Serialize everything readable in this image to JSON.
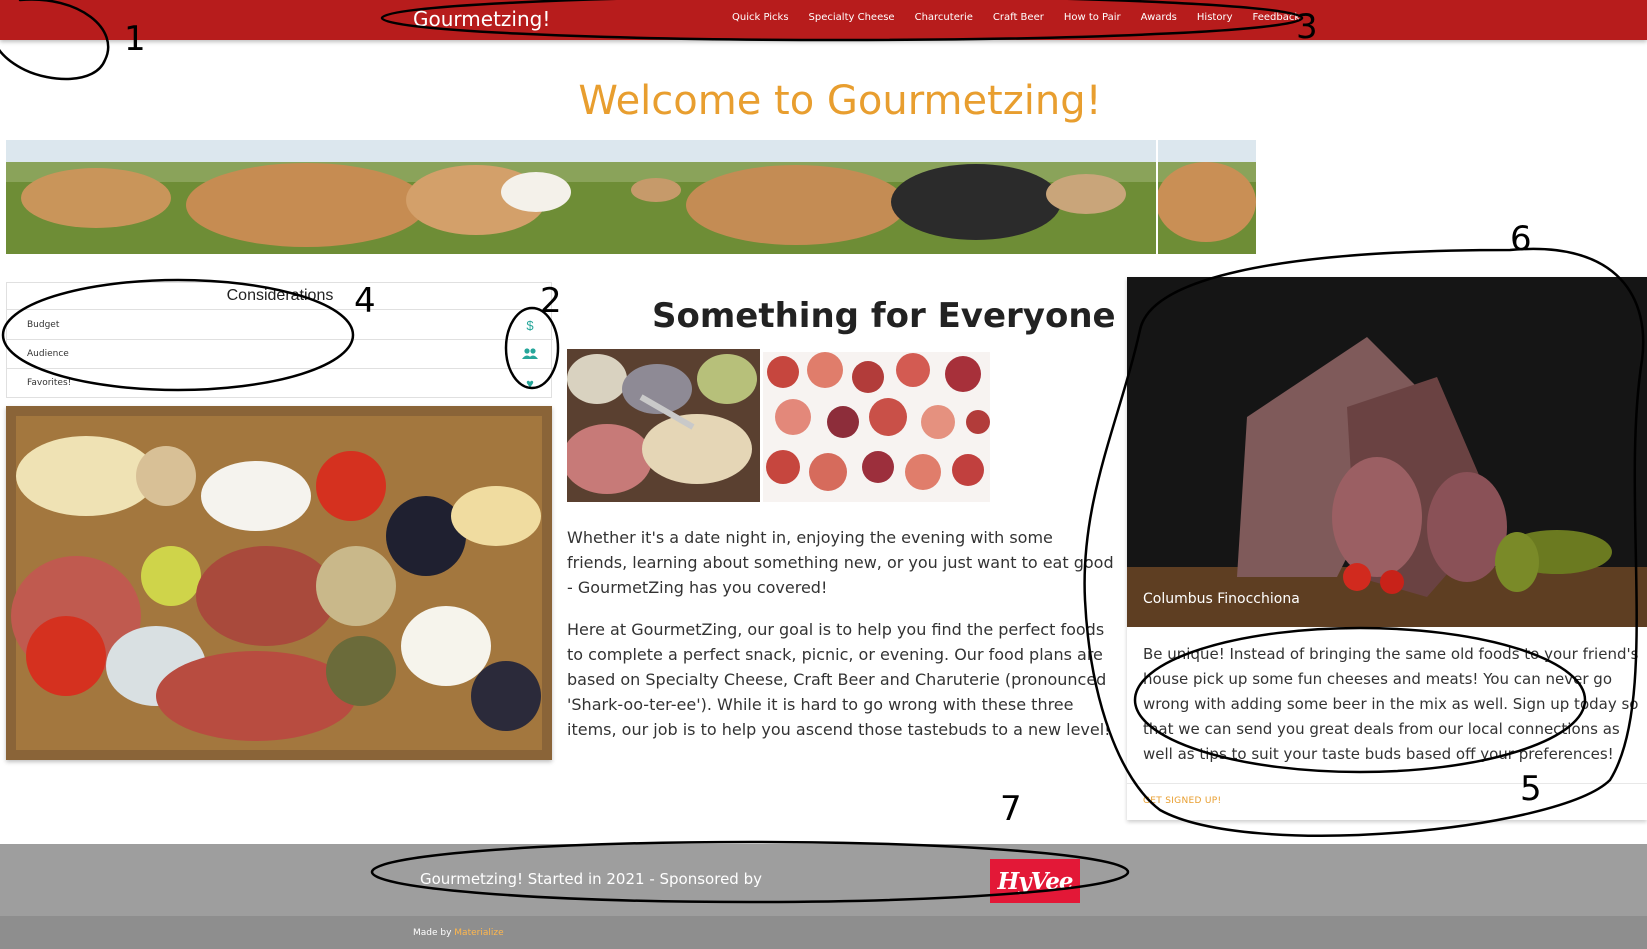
{
  "navbar": {
    "brand": "Gourmetzing!",
    "links": [
      "Quick Picks",
      "Specialty Cheese",
      "Charcuterie",
      "Craft Beer",
      "How to Pair",
      "Awards",
      "History",
      "Feedback"
    ]
  },
  "hero": {
    "title": "Welcome to Gourmetzing!"
  },
  "considerations": {
    "header": "Considerations",
    "items": [
      {
        "label": "Budget",
        "icon": "dollar-icon"
      },
      {
        "label": "Audience",
        "icon": "people-icon"
      },
      {
        "label": "Favorites!",
        "icon": "heart-icon"
      }
    ]
  },
  "center": {
    "title": "Something for Everyone",
    "paragraph1": "Whether it's a date night in, enjoying the evening with some friends, learning about something new, or you just want to eat good - GourmetZing has you covered!",
    "paragraph2": "Here at GourmetZing, our goal is to help you find the perfect foods to complete a perfect snack, picnic, or evening. Our food plans are based on Specialty Cheese, Craft Beer and Charuterie (pronounced 'Shark-oo-ter-ee'). While it is hard to go wrong with these three items, our job is to help you ascend those tastebuds to a new level!"
  },
  "card": {
    "title": "Columbus Finocchiona",
    "content": "Be unique! Instead of bringing the same old foods to your friend's house pick up some fun cheeses and meats! You can never go wrong with adding some beer in the mix as well. Sign up today so that we can send you great deals from our local connections as well as tips to suit your taste buds based off your preferences!",
    "action": "GET SIGNED UP!"
  },
  "footer": {
    "text": "Gourmetzing! Started in 2021 - Sponsored by",
    "sponsor_logo": "HyVee",
    "made_by": "Made by ",
    "made_by_link": "Materialize"
  },
  "annotations": [
    "1",
    "2",
    "3",
    "4",
    "5",
    "6",
    "7"
  ],
  "colors": {
    "navbar": "#b71c1c",
    "title_accent": "#e89e2f",
    "icon_teal": "#26a69a",
    "footer": "#9e9e9e",
    "sponsor_red": "#e31837"
  }
}
